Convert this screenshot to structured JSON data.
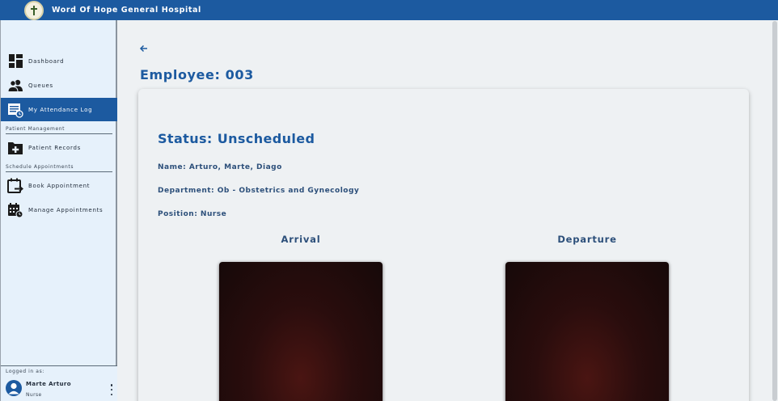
{
  "app": {
    "title": "Word Of Hope General Hospital"
  },
  "sidebar": {
    "items": [
      {
        "label": "Dashboard",
        "icon": "dashboard-icon"
      },
      {
        "label": "Queues",
        "icon": "people-icon"
      },
      {
        "label": "My Attendance Log",
        "icon": "attendance-log-icon",
        "active": true
      }
    ],
    "sections": [
      {
        "title": "Patient Management",
        "items": [
          {
            "label": "Patient Records",
            "icon": "add-folder-icon"
          }
        ]
      },
      {
        "title": "Schedule Appointments",
        "items": [
          {
            "label": "Book Appointment",
            "icon": "calendar-arrow-icon"
          },
          {
            "label": "Manage Appointments",
            "icon": "calendar-clock-icon"
          }
        ]
      }
    ],
    "footer": {
      "logged_in_label": "Logged in as:",
      "user_name": "Marte Arturo",
      "user_role": "Nurse"
    }
  },
  "main": {
    "title": "Employee: 003",
    "status": "Status: Unscheduled",
    "name": "Name: Arturo, Marte, Diago",
    "department": "Department: Ob - Obstetrics and Gynecology",
    "position": "Position: Nurse",
    "arrival_label": "Arrival",
    "departure_label": "Departure"
  },
  "colors": {
    "brand": "#1c5aa0",
    "sidebar_bg": "#e6f1fb",
    "page_bg": "#eef1f3",
    "heading": "#1c5aa0",
    "info_text": "#2c4f7a"
  }
}
